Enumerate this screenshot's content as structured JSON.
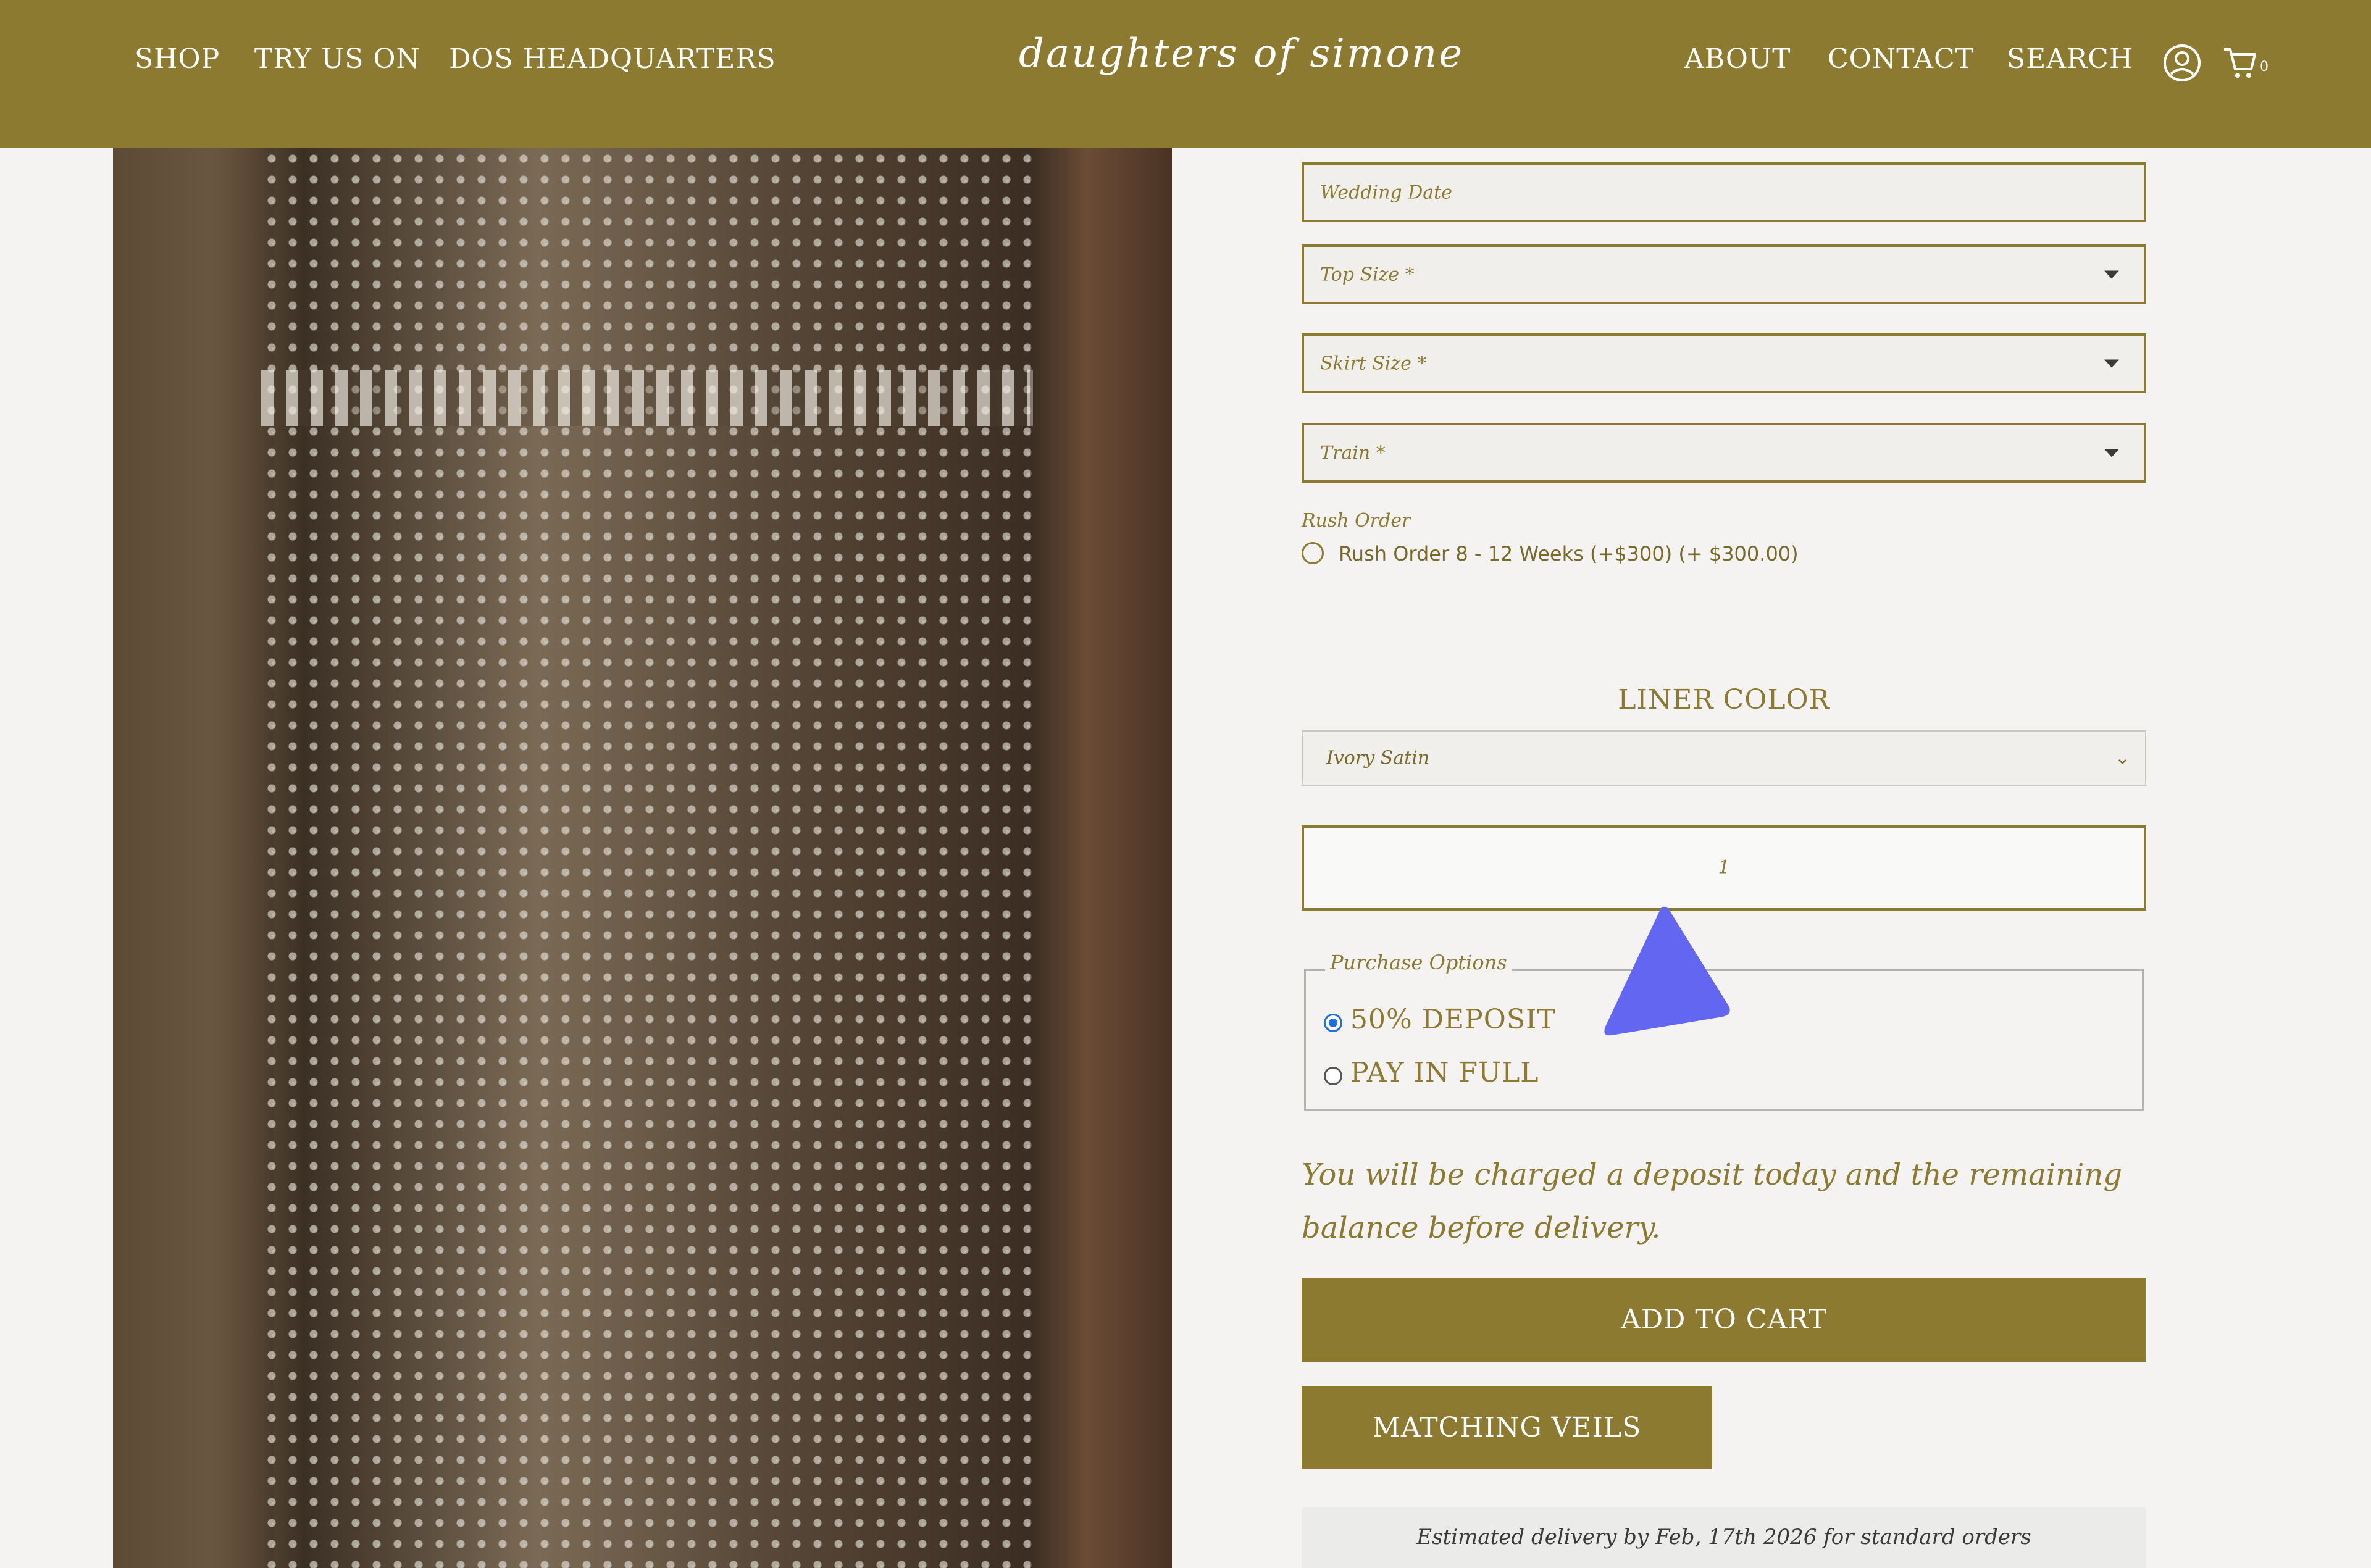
{
  "header": {
    "nav_left": [
      "SHOP",
      "TRY US ON",
      "DOS HEADQUARTERS"
    ],
    "logo_text": "daughters of simone",
    "nav_right": [
      "ABOUT",
      "CONTACT",
      "SEARCH"
    ],
    "cart_count": "0",
    "background_color": "#8c7a31"
  },
  "form": {
    "wedding_date_placeholder": "Wedding Date",
    "top_size_placeholder": "Top Size *",
    "skirt_size_placeholder": "Skirt Size *",
    "train_placeholder": "Train *",
    "rush_order_label": "Rush Order",
    "rush_order_option": "Rush Order 8 - 12 Weeks (+$300) (+ $300.00)",
    "liner_color_title": "LINER COLOR",
    "liner_color_value": "Ivory Satin",
    "quantity_value": "1",
    "purchase_options_legend": "Purchase Options",
    "purchase_options": [
      "50% DEPOSIT",
      "PAY IN FULL"
    ],
    "purchase_selected": "50% DEPOSIT",
    "deposit_note": "You will be charged a deposit today and the remaining balance before delivery.",
    "add_to_cart_label": "ADD TO CART",
    "matching_veils_label": "MATCHING VEILS",
    "delivery_estimate": "Estimated delivery by Feb, 17th 2026 for standard orders"
  },
  "icons": {
    "account": "user-circle-icon",
    "cart": "shopping-cart-icon",
    "cursor": "pointer-cursor-icon"
  },
  "colors": {
    "accent": "#8c7a31",
    "cursor": "#6366f1",
    "radio_selected": "#1f6fe0"
  }
}
